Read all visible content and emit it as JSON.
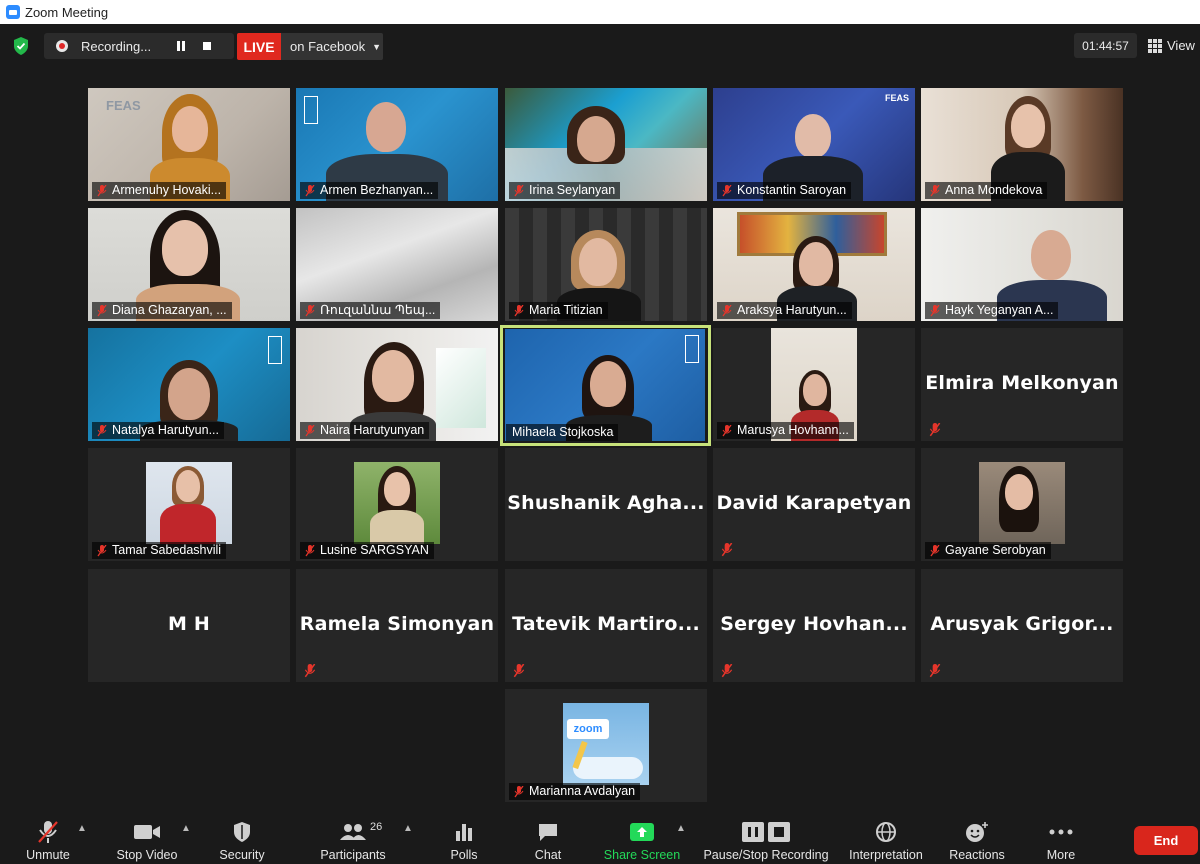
{
  "window": {
    "title": "Zoom Meeting"
  },
  "topbar": {
    "recording_label": "Recording...",
    "live_label": "LIVE",
    "live_target": "on Facebook",
    "timer": "01:44:57",
    "view_label": "View"
  },
  "participants": [
    "Armenuhy Hovaki...",
    "Armen Bezhanyan...",
    "Irina Seylanyan",
    "Konstantin Saroyan",
    "Anna Mondekova",
    "Diana Ghazaryan, ...",
    "Ռուզաննա Պեպ...",
    "Maria Titizian",
    "Araksya Harutyun...",
    "Hayk Yeganyan A...",
    "Natalya Harutyun...",
    "Naira Harutyunyan",
    "Mihaela Stojkoska",
    "Marusya Hovhann...",
    "Elmira Melkonyan",
    "Tamar Sabedashvili",
    "Lusine SARGSYAN",
    "Shushanik  Agha...",
    "David Karapetyan",
    "Gayane Serobyan",
    "M H",
    "Ramela Simonyan",
    "Tatevik  Martiro...",
    "Sergey  Hovhan...",
    "Arusyak  Grigor...",
    "Marianna Avdalyan"
  ],
  "logos": {
    "feas": "FEAS",
    "zoom": "zoom"
  },
  "toolbar": {
    "unmute": "Unmute",
    "stop_video": "Stop Video",
    "security": "Security",
    "participants": "Participants",
    "participants_count": "26",
    "polls": "Polls",
    "chat": "Chat",
    "share_screen": "Share Screen",
    "pause_stop_recording": "Pause/Stop Recording",
    "interpretation": "Interpretation",
    "reactions": "Reactions",
    "more": "More",
    "end": "End"
  },
  "colors": {
    "live": "#e0291f",
    "share": "#23d959",
    "end": "#d9261c",
    "active_border": "#c7e27a"
  }
}
